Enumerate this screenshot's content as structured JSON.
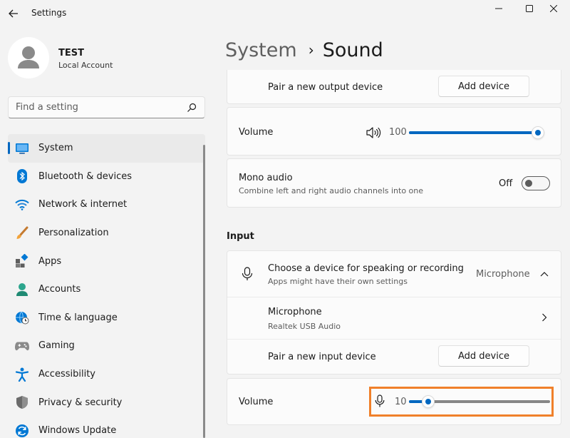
{
  "window": {
    "title": "Settings"
  },
  "profile": {
    "name": "TEST",
    "account_type": "Local Account"
  },
  "search": {
    "placeholder": "Find a setting"
  },
  "nav": {
    "items": [
      {
        "label": "System",
        "icon": "system-icon",
        "active": true
      },
      {
        "label": "Bluetooth & devices",
        "icon": "bluetooth-icon"
      },
      {
        "label": "Network & internet",
        "icon": "wifi-icon"
      },
      {
        "label": "Personalization",
        "icon": "brush-icon"
      },
      {
        "label": "Apps",
        "icon": "apps-icon"
      },
      {
        "label": "Accounts",
        "icon": "person-icon"
      },
      {
        "label": "Time & language",
        "icon": "globe-clock-icon"
      },
      {
        "label": "Gaming",
        "icon": "gamepad-icon"
      },
      {
        "label": "Accessibility",
        "icon": "accessibility-icon"
      },
      {
        "label": "Privacy & security",
        "icon": "shield-icon"
      },
      {
        "label": "Windows Update",
        "icon": "update-icon"
      }
    ]
  },
  "breadcrumb": {
    "parent": "System",
    "current": "Sound"
  },
  "output": {
    "pair_label": "Pair a new output device",
    "add_device": "Add device",
    "volume_label": "Volume",
    "volume_value": "100",
    "volume_level": 1.0,
    "mono_title": "Mono audio",
    "mono_subtitle": "Combine left and right audio channels into one",
    "mono_state": "Off"
  },
  "input": {
    "section_title": "Input",
    "choose_title": "Choose a device for speaking or recording",
    "choose_subtitle": "Apps might have their own settings",
    "selected_device": "Microphone",
    "device_name": "Microphone",
    "device_detail": "Realtek USB Audio",
    "pair_label": "Pair a new input device",
    "add_device": "Add device",
    "volume_label": "Volume",
    "volume_value": "10",
    "volume_level": 0.1
  },
  "colors": {
    "accent": "#0067c0",
    "highlight": "#f0802a",
    "background": "#f3f3f3"
  }
}
